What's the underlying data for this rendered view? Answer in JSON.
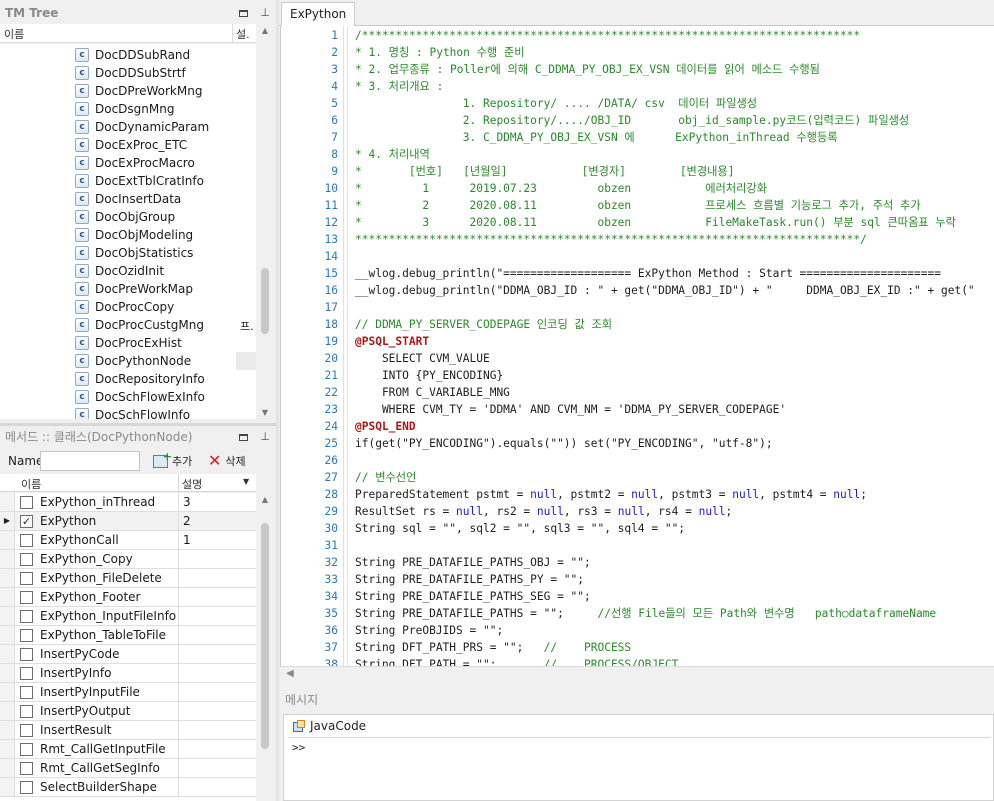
{
  "tree_panel": {
    "title": "TM Tree",
    "col_name": "이름",
    "col_desc": "설.",
    "items": [
      {
        "label": "DocDDSubRand",
        "desc": ""
      },
      {
        "label": "DocDDSubStrtf",
        "desc": ""
      },
      {
        "label": "DocDPreWorkMng",
        "desc": ""
      },
      {
        "label": "DocDsgnMng",
        "desc": ""
      },
      {
        "label": "DocDynamicParam",
        "desc": ""
      },
      {
        "label": "DocExProc_ETC",
        "desc": ""
      },
      {
        "label": "DocExProcMacro",
        "desc": ""
      },
      {
        "label": "DocExtTblCratInfo",
        "desc": ""
      },
      {
        "label": "DocInsertData",
        "desc": ""
      },
      {
        "label": "DocObjGroup",
        "desc": ""
      },
      {
        "label": "DocObjModeling",
        "desc": ""
      },
      {
        "label": "DocObjStatistics",
        "desc": ""
      },
      {
        "label": "DocOzidInit",
        "desc": ""
      },
      {
        "label": "DocPreWorkMap",
        "desc": ""
      },
      {
        "label": "DocProcCopy",
        "desc": ""
      },
      {
        "label": "DocProcCustgMng",
        "desc": "프."
      },
      {
        "label": "DocProcExHist",
        "desc": ""
      },
      {
        "label": "DocPythonNode",
        "desc": ""
      },
      {
        "label": "DocRepositoryInfo",
        "desc": ""
      },
      {
        "label": "DocSchFlowExInfo",
        "desc": ""
      },
      {
        "label": "DocSchFlowInfo",
        "desc": ""
      }
    ],
    "selected_index": 17
  },
  "method_panel": {
    "title": "메서드 :: 클래스(DocPythonNode)",
    "name_label": "Name",
    "name_value": "",
    "add_label": "추가",
    "delete_label": "삭제",
    "col_name": "이름",
    "col_desc": "설명",
    "rows": [
      {
        "name": "ExPython_inThread",
        "desc": "3",
        "checked": false
      },
      {
        "name": "ExPython",
        "desc": "2",
        "checked": true
      },
      {
        "name": "ExPythonCall",
        "desc": "1",
        "checked": false
      },
      {
        "name": "ExPython_Copy",
        "desc": "",
        "checked": false
      },
      {
        "name": "ExPython_FileDelete",
        "desc": "",
        "checked": false
      },
      {
        "name": "ExPython_Footer",
        "desc": "",
        "checked": false
      },
      {
        "name": "ExPython_InputFileInfo",
        "desc": "",
        "checked": false
      },
      {
        "name": "ExPython_TableToFile",
        "desc": "",
        "checked": false
      },
      {
        "name": "InsertPyCode",
        "desc": "",
        "checked": false
      },
      {
        "name": "InsertPyInfo",
        "desc": "",
        "checked": false
      },
      {
        "name": "InsertPyInputFile",
        "desc": "",
        "checked": false
      },
      {
        "name": "InsertPyOutput",
        "desc": "",
        "checked": false
      },
      {
        "name": "InsertResult",
        "desc": "",
        "checked": false
      },
      {
        "name": "Rmt_CallGetInputFile",
        "desc": "",
        "checked": false
      },
      {
        "name": "Rmt_CallGetSegInfo",
        "desc": "",
        "checked": false
      },
      {
        "name": "SelectBuilderShape",
        "desc": "",
        "checked": false
      }
    ],
    "active_row": 1
  },
  "editor": {
    "tab": "ExPython",
    "lines": [
      {
        "n": "1",
        "s": [
          {
            "t": "/**************************************************************************",
            "c": "com"
          }
        ]
      },
      {
        "n": "2",
        "s": [
          {
            "t": "* 1. 명칭 : Python 수행 준비",
            "c": "com"
          }
        ]
      },
      {
        "n": "3",
        "s": [
          {
            "t": "* 2. 업무종류 : Poller에 의해 C_DDMA_PY_OBJ_EX_VSN 데이터를 읽어 메소드 수행됨",
            "c": "com"
          }
        ]
      },
      {
        "n": "4",
        "s": [
          {
            "t": "* 3. 처리개요 :",
            "c": "com"
          }
        ]
      },
      {
        "n": "5",
        "s": [
          {
            "t": "                1. Repository/ .... /DATA/ csv  데이터 파일생성",
            "c": "com"
          }
        ]
      },
      {
        "n": "6",
        "s": [
          {
            "t": "                2. Repository/..../OBJ_ID       obj_id_sample.py코드(입력코드) 파일생성",
            "c": "com"
          }
        ]
      },
      {
        "n": "7",
        "s": [
          {
            "t": "                3. C_DDMA_PY_OBJ_EX_VSN 에      ExPython_inThread 수행등록",
            "c": "com"
          }
        ]
      },
      {
        "n": "8",
        "s": [
          {
            "t": "* 4. 처리내역",
            "c": "com"
          }
        ]
      },
      {
        "n": "9",
        "s": [
          {
            "t": "*       [번호]   [년월일]           [변경자]        [변경내용]",
            "c": "com"
          }
        ]
      },
      {
        "n": "10",
        "s": [
          {
            "t": "*         1      2019.07.23         obzen           에러처리강화",
            "c": "com"
          }
        ]
      },
      {
        "n": "11",
        "s": [
          {
            "t": "*         2      2020.08.11         obzen           프로세스 흐름별 기능로그 추가, 주석 추가",
            "c": "com"
          }
        ]
      },
      {
        "n": "12",
        "s": [
          {
            "t": "*         3      2020.08.11         obzen           FileMakeTask.run() 부분 sql 큰따옴표 누락",
            "c": "com"
          }
        ]
      },
      {
        "n": "13",
        "s": [
          {
            "t": "***************************************************************************/",
            "c": "com"
          }
        ]
      },
      {
        "n": "14",
        "s": []
      },
      {
        "n": "15",
        "s": [
          {
            "t": "__wlog.debug_println(\"=================== ExPython Method : Start =====================",
            "c": "str"
          }
        ]
      },
      {
        "n": "16",
        "s": [
          {
            "t": "__wlog.debug_println(\"DDMA_OBJ_ID : \" + get(\"DDMA_OBJ_ID\") + \"     DDMA_OBJ_EX_ID :\" + get(\"",
            "c": "str"
          }
        ]
      },
      {
        "n": "17",
        "s": []
      },
      {
        "n": "18",
        "s": [
          {
            "t": "// DDMA_PY_SERVER_CODEPAGE 인코딩 값 조회",
            "c": "com"
          }
        ]
      },
      {
        "n": "19",
        "s": [
          {
            "t": "@PSQL_START",
            "c": "ann"
          }
        ]
      },
      {
        "n": "20",
        "s": [
          {
            "t": "    SELECT CVM_VALUE",
            "c": "str"
          }
        ]
      },
      {
        "n": "21",
        "s": [
          {
            "t": "    INTO {PY_ENCODING}",
            "c": "str"
          }
        ]
      },
      {
        "n": "22",
        "s": [
          {
            "t": "    FROM C_VARIABLE_MNG",
            "c": "str"
          }
        ]
      },
      {
        "n": "23",
        "s": [
          {
            "t": "    WHERE CVM_TY = 'DDMA' AND CVM_NM = 'DDMA_PY_SERVER_CODEPAGE'",
            "c": "str"
          }
        ]
      },
      {
        "n": "24",
        "s": [
          {
            "t": "@PSQL_END",
            "c": "ann"
          }
        ]
      },
      {
        "n": "25",
        "s": [
          {
            "t": "if(get(\"PY_ENCODING\").equals(\"\")) set(\"PY_ENCODING\", \"utf-8\");",
            "c": "str"
          }
        ]
      },
      {
        "n": "26",
        "s": []
      },
      {
        "n": "27",
        "s": [
          {
            "t": "// 변수선언",
            "c": "com"
          }
        ]
      },
      {
        "n": "28",
        "s": [
          {
            "t": "PreparedStatement pstmt = ",
            "c": "str"
          },
          {
            "t": "null",
            "c": "kw"
          },
          {
            "t": ", pstmt2 = ",
            "c": "str"
          },
          {
            "t": "null",
            "c": "kw"
          },
          {
            "t": ", pstmt3 = ",
            "c": "str"
          },
          {
            "t": "null",
            "c": "kw"
          },
          {
            "t": ", pstmt4 = ",
            "c": "str"
          },
          {
            "t": "null",
            "c": "kw"
          },
          {
            "t": ";",
            "c": "str"
          }
        ]
      },
      {
        "n": "29",
        "s": [
          {
            "t": "ResultSet rs = ",
            "c": "str"
          },
          {
            "t": "null",
            "c": "kw"
          },
          {
            "t": ", rs2 = ",
            "c": "str"
          },
          {
            "t": "null",
            "c": "kw"
          },
          {
            "t": ", rs3 = ",
            "c": "str"
          },
          {
            "t": "null",
            "c": "kw"
          },
          {
            "t": ", rs4 = ",
            "c": "str"
          },
          {
            "t": "null",
            "c": "kw"
          },
          {
            "t": ";",
            "c": "str"
          }
        ]
      },
      {
        "n": "30",
        "s": [
          {
            "t": "String sql = \"\", sql2 = \"\", sql3 = \"\", sql4 = \"\";",
            "c": "str"
          }
        ]
      },
      {
        "n": "31",
        "s": []
      },
      {
        "n": "32",
        "s": [
          {
            "t": "String PRE_DATAFILE_PATHS_OBJ = \"\";",
            "c": "str"
          }
        ]
      },
      {
        "n": "33",
        "s": [
          {
            "t": "String PRE_DATAFILE_PATHS_PY = \"\";",
            "c": "str"
          }
        ]
      },
      {
        "n": "34",
        "s": [
          {
            "t": "String PRE_DATAFILE_PATHS_SEG = \"\";",
            "c": "str"
          }
        ]
      },
      {
        "n": "35",
        "s": [
          {
            "t": "String PRE_DATAFILE_PATHS = \"\";     ",
            "c": "str"
          },
          {
            "t": "//선행 File들의 모든 Path와 변수명   path○dataframeName",
            "c": "com"
          }
        ]
      },
      {
        "n": "36",
        "s": [
          {
            "t": "String PreOBJIDS = \"\";",
            "c": "str"
          }
        ]
      },
      {
        "n": "37",
        "s": [
          {
            "t": "String DFT_PATH_PRS = \"\";   ",
            "c": "str"
          },
          {
            "t": "//    PROCESS",
            "c": "com"
          }
        ]
      },
      {
        "n": "38",
        "s": [
          {
            "t": "String DFT_PATH = \"\";       ",
            "c": "str"
          },
          {
            "t": "//    PROCESS/OBJECT",
            "c": "com"
          }
        ]
      }
    ]
  },
  "message_panel": {
    "title": "메시지",
    "tab": "JavaCode",
    "prompt": ">>"
  }
}
